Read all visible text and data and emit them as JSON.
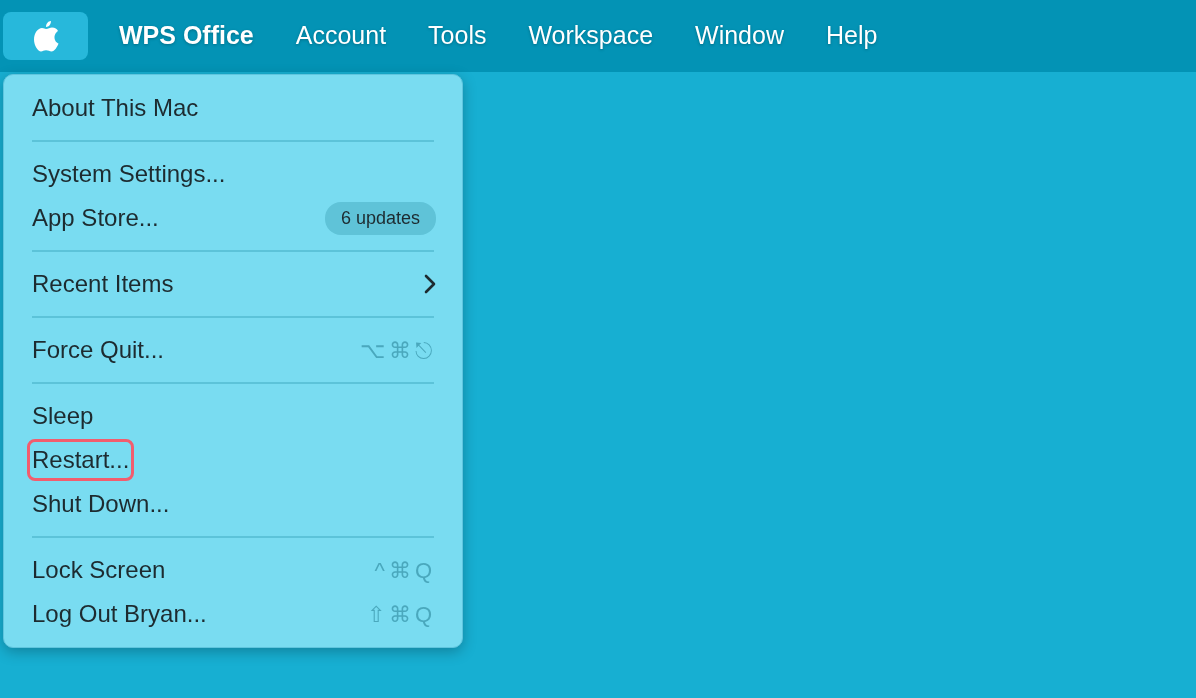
{
  "menu_bar": {
    "apple_menu": {
      "selected": true
    },
    "menus": [
      {
        "label": "WPS Office",
        "kind": "app"
      },
      {
        "label": "Account",
        "kind": "menu"
      },
      {
        "label": "Tools",
        "kind": "menu"
      },
      {
        "label": "Workspace",
        "kind": "menu"
      },
      {
        "label": "Window",
        "kind": "menu"
      },
      {
        "label": "Help",
        "kind": "menu"
      }
    ]
  },
  "apple_menu": {
    "sections": [
      {
        "items": [
          {
            "label": "About This Mac",
            "highlighted": false
          }
        ]
      },
      {
        "items": [
          {
            "label": "System Settings...",
            "highlighted": false
          },
          {
            "label": "App Store...",
            "badge": "6 updates",
            "highlighted": false
          }
        ]
      },
      {
        "items": [
          {
            "label": "Recent Items",
            "submenu": true,
            "highlighted": false
          }
        ]
      },
      {
        "items": [
          {
            "label": "Force Quit...",
            "shortcut": "⌥⌘⎋",
            "highlighted": false
          }
        ]
      },
      {
        "items": [
          {
            "label": "Sleep",
            "highlighted": false
          },
          {
            "label": "Restart...",
            "highlighted": true
          },
          {
            "label": "Shut Down...",
            "highlighted": false
          }
        ]
      },
      {
        "items": [
          {
            "label": "Lock Screen",
            "shortcut": "^⌘Q",
            "highlighted": false
          },
          {
            "label": "Log Out Bryan...",
            "shortcut": "⇧⌘Q",
            "highlighted": false
          }
        ]
      }
    ]
  }
}
